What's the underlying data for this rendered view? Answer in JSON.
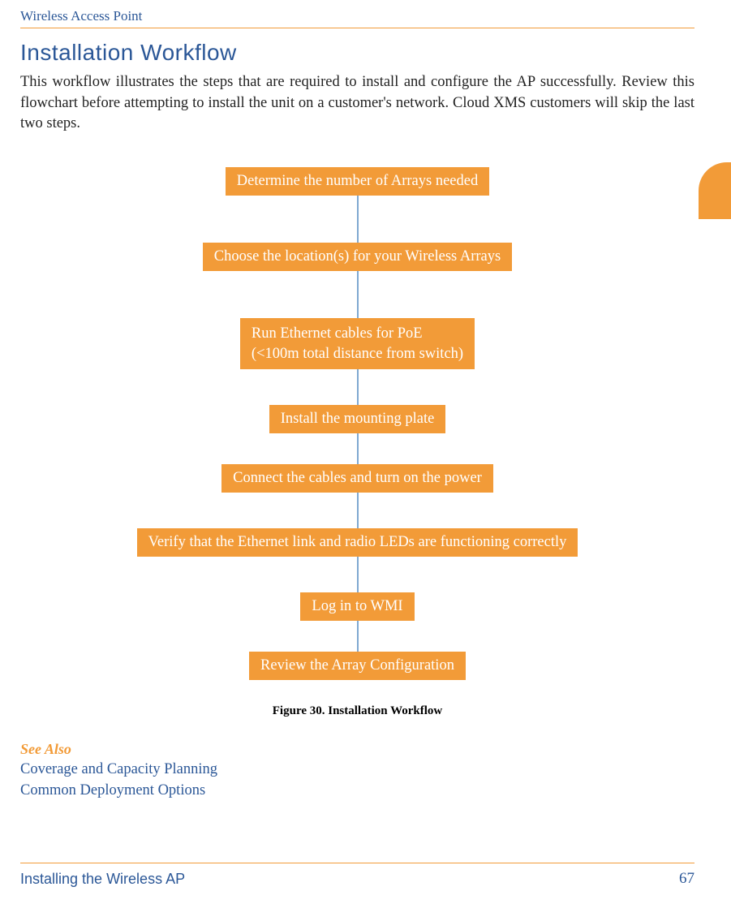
{
  "header": "Wireless Access Point",
  "title": "Installation Workflow",
  "body": "This workflow illustrates the steps that are required to install and configure the AP successfully. Review this flowchart before attempting to install the unit on a customer's network. Cloud XMS customers will skip the last two steps.",
  "flow": {
    "step1": "Determine the number of Arrays needed",
    "step2": "Choose the location(s) for your Wireless Arrays",
    "step3a": "Run Ethernet cables for PoE",
    "step3b": "(<100m total distance from switch)",
    "step4": "Install the mounting plate",
    "step5": "Connect the cables and turn on the power",
    "step6": "Verify that the Ethernet link and radio LEDs are functioning correctly",
    "step7": "Log in to WMI",
    "step8": "Review the Array Configuration"
  },
  "caption": "Figure 30. Installation Workflow",
  "see_also": {
    "label": "See Also",
    "link1": "Coverage and Capacity Planning",
    "link2": "Common Deployment Options"
  },
  "footer": {
    "left": "Installing the Wireless AP",
    "right": "67"
  }
}
